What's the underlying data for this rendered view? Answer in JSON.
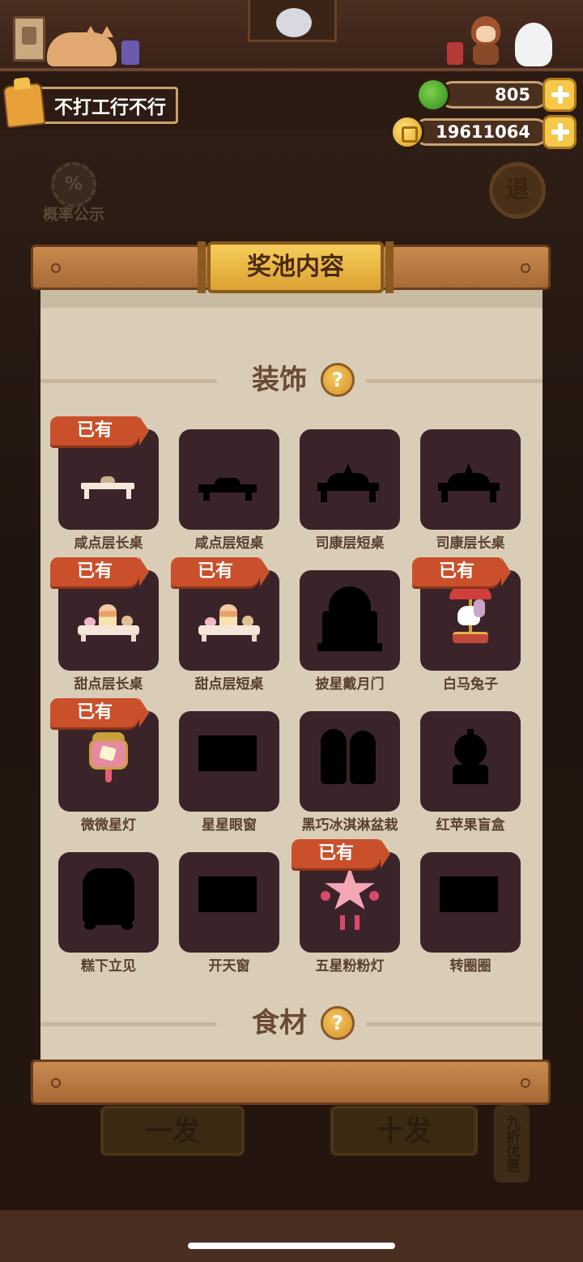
{
  "player": {
    "name": "不打工行不行"
  },
  "currency": {
    "gems": "805",
    "coins": "19611064"
  },
  "background": {
    "probability_label": "概率公示",
    "probability_symbol": "%",
    "exit_label": "退",
    "single_draw": "一发",
    "ten_draw": "十发",
    "discount": "九折优惠"
  },
  "panel": {
    "title": "奖池内容",
    "help_symbol": "?",
    "sections": [
      {
        "title": "装饰"
      },
      {
        "title": "食材"
      }
    ],
    "owned_label": "已有",
    "items": [
      {
        "name": "咸点层长桌",
        "owned": true
      },
      {
        "name": "咸点层短桌",
        "owned": false
      },
      {
        "name": "司康层短桌",
        "owned": false
      },
      {
        "name": "司康层长桌",
        "owned": false
      },
      {
        "name": "甜点层长桌",
        "owned": true
      },
      {
        "name": "甜点层短桌",
        "owned": true
      },
      {
        "name": "披星戴月门",
        "owned": false
      },
      {
        "name": "白马兔子",
        "owned": true
      },
      {
        "name": "微微星灯",
        "owned": true
      },
      {
        "name": "星星眼窗",
        "owned": false
      },
      {
        "name": "黑巧冰淇淋盆栽",
        "owned": false
      },
      {
        "name": "红苹果盲盒",
        "owned": false
      },
      {
        "name": "糕下立见",
        "owned": false
      },
      {
        "name": "开天窗",
        "owned": false
      },
      {
        "name": "五星粉粉灯",
        "owned": true
      },
      {
        "name": "转圈圈",
        "owned": false
      }
    ]
  },
  "colors": {
    "panel_paper": "#d9cdb8",
    "tile_bg": "#3b2429",
    "owned_badge": "#c9502a",
    "title_plate": "#f6cd5a"
  }
}
